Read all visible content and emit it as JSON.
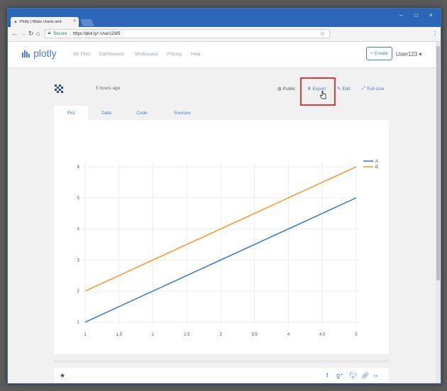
{
  "browser": {
    "tab_title": "Plotly | Make charts and",
    "tab_close": "×",
    "secure_label": "Secure",
    "url": "https://plot.ly/~User123/5",
    "window_controls": [
      "–",
      "□",
      "×"
    ]
  },
  "site": {
    "logo": "plotly",
    "nav": [
      "My Files",
      "Dashboards",
      "Workspace",
      "Pricing",
      "Help"
    ],
    "create": "+ Create",
    "user": "User123"
  },
  "plot_header": {
    "time": "5 hours ago",
    "public": "Public",
    "export": "Export",
    "edit": "Edit",
    "fullsize": "Full-size"
  },
  "plot_tabs": [
    "Plot",
    "Data",
    "Code",
    "Sources"
  ],
  "chart_data": {
    "type": "line",
    "x": [
      1,
      2,
      3,
      4,
      5
    ],
    "series": [
      {
        "name": "A",
        "values": [
          1,
          2,
          3,
          4,
          5
        ],
        "color": "#3d7fc1"
      },
      {
        "name": "B",
        "values": [
          2,
          3,
          4,
          5,
          6
        ],
        "color": "#ff9833"
      }
    ],
    "xlim": [
      1,
      5
    ],
    "ylim": [
      1,
      6
    ],
    "x_ticks": [
      "1",
      "1.5",
      "2",
      "2.5",
      "3",
      "3.5",
      "4",
      "4.5",
      "5"
    ],
    "y_ticks": [
      "1",
      "2",
      "3",
      "4",
      "5",
      "6"
    ],
    "grid": true,
    "legend": "top-right"
  },
  "icons": {
    "star": "star-icon",
    "facebook": "facebook-icon",
    "googleplus": "google-plus-icon",
    "twitter": "twitter-icon",
    "link": "link-icon",
    "embed": "embed-icon"
  }
}
